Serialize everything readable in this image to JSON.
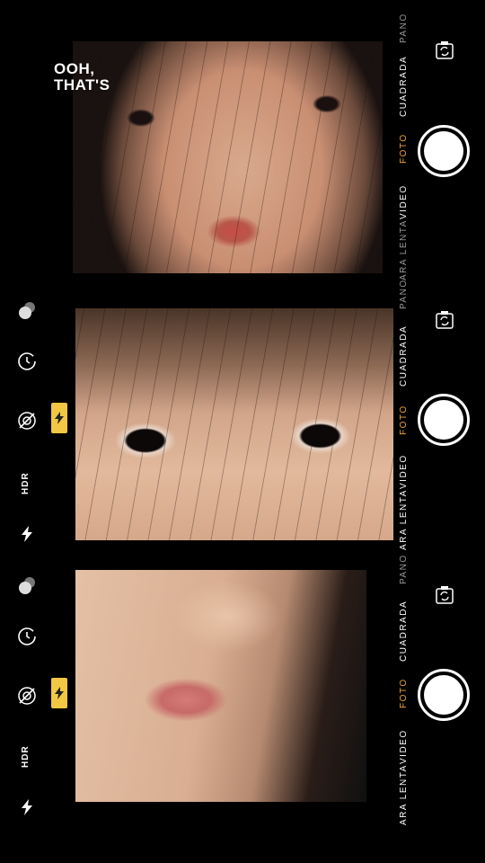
{
  "overlay_caption": {
    "line1": "OOH,",
    "line2": "THAT'S"
  },
  "modes": {
    "pano": "PANO",
    "square": "CUADRADA",
    "photo": "FOTO",
    "video": "VIDEO",
    "slowmo": "ARA LENTA"
  },
  "hdr_label": "HDR",
  "colors": {
    "active_mode": "#f2a93b",
    "flash_badge": "#f3c744"
  },
  "icons": [
    "live-photo-icon",
    "timer-icon",
    "filters-off-icon",
    "flash-icon",
    "switch-camera-icon",
    "shutter-button"
  ]
}
